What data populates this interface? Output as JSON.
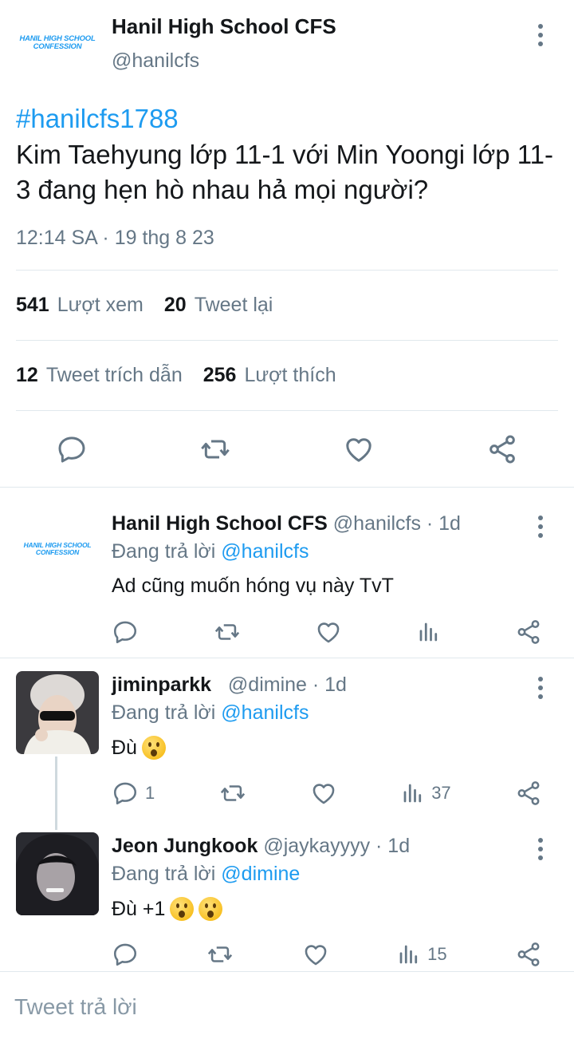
{
  "main_tweet": {
    "logo_text": "HANIL HIGH SCHOOL CONFESSION",
    "author_name": "Hanil High School CFS",
    "author_handle": "@hanilcfs",
    "hashtag": "#hanilcfs1788",
    "text": "Kim Taehyung lớp 11-1 với Min Yoongi lớp 11-3 đang hẹn hò nhau hả mọi người?",
    "timestamp": "12:14 SA · 19 thg 8 23",
    "stats": {
      "views_count": "541",
      "views_label": "Lượt xem",
      "retweets_count": "20",
      "retweets_label": "Tweet lại",
      "quotes_count": "12",
      "quotes_label": "Tweet trích dẫn",
      "likes_count": "256",
      "likes_label": "Lượt thích"
    }
  },
  "replies": [
    {
      "logo_text": "HANIL HIGH SCHOOL CONFESSION",
      "name": "Hanil High School CFS",
      "meta": "@hanilcfs · 1d",
      "replying_prefix": "Đang trả lời",
      "replying_to": "@hanilcfs",
      "text": "Ad cũng muốn hóng vụ này TvT",
      "reply_count": "",
      "views_count": ""
    },
    {
      "name": "jiminparkk",
      "meta": "@dimine · 1d",
      "replying_prefix": "Đang trả lời",
      "replying_to": "@hanilcfs",
      "text": "Đù",
      "emoji_count": 1,
      "reply_count": "1",
      "views_count": "37"
    },
    {
      "name": "Jeon Jungkook",
      "meta": "@jaykayyyy · 1d",
      "replying_prefix": "Đang trả lời",
      "replying_to": "@dimine",
      "text": "Đù +1",
      "emoji_count": 2,
      "reply_count": "",
      "views_count": "15"
    }
  ],
  "compose": {
    "placeholder": "Tweet trả lời"
  },
  "colors": {
    "accent": "#1d9bf0",
    "muted": "#657786",
    "text": "#14171a",
    "divider": "#e1e8ed"
  },
  "icons": [
    "reply-icon",
    "retweet-icon",
    "like-icon",
    "share-icon",
    "views-icon",
    "more-icon",
    "emoji-hushed-icon"
  ]
}
